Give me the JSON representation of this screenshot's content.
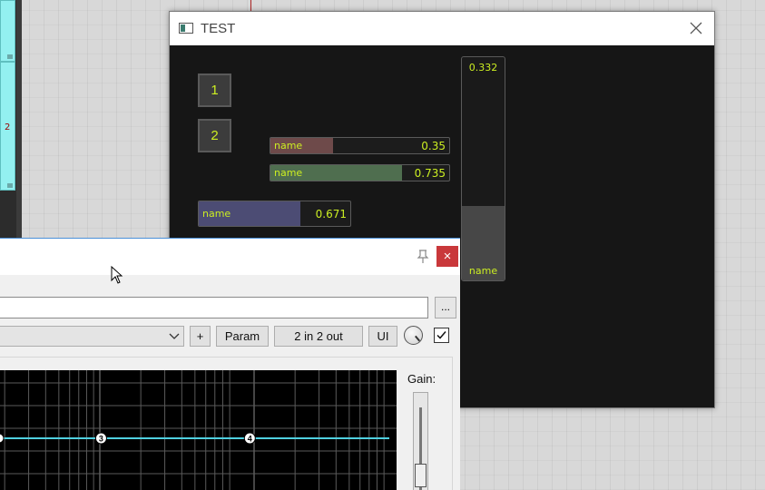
{
  "background": {
    "track_number": "2"
  },
  "test_window": {
    "title": "TEST",
    "buttons": [
      "1",
      "2"
    ],
    "sliders": [
      {
        "label": "name",
        "value": "0.35",
        "fraction": 0.35,
        "color": "#6e4a4a"
      },
      {
        "label": "name",
        "value": "0.735",
        "fraction": 0.735,
        "color": "#4f6e4f"
      },
      {
        "label": "name",
        "value": "0.671",
        "fraction": 0.671,
        "color": "#4c4c74"
      }
    ],
    "vertical_slider": {
      "label": "name",
      "value": "0.332",
      "fraction": 0.332
    },
    "accent_text_color": "#ccee22"
  },
  "plugin_window": {
    "close_icon": "×",
    "path_value": "",
    "browse_label": "...",
    "preset_value": "",
    "buttons": {
      "plus": "+",
      "param": "Param",
      "io": "2 in 2 out",
      "ui": "UI"
    },
    "bypass_checked": true,
    "gain_label": "Gain:",
    "eq_points": [
      {
        "label": "3",
        "pos": 0.255
      },
      {
        "label": "4",
        "pos": 0.63
      }
    ],
    "close_color": "#c9383b",
    "curve_color": "#4fd0e0"
  }
}
